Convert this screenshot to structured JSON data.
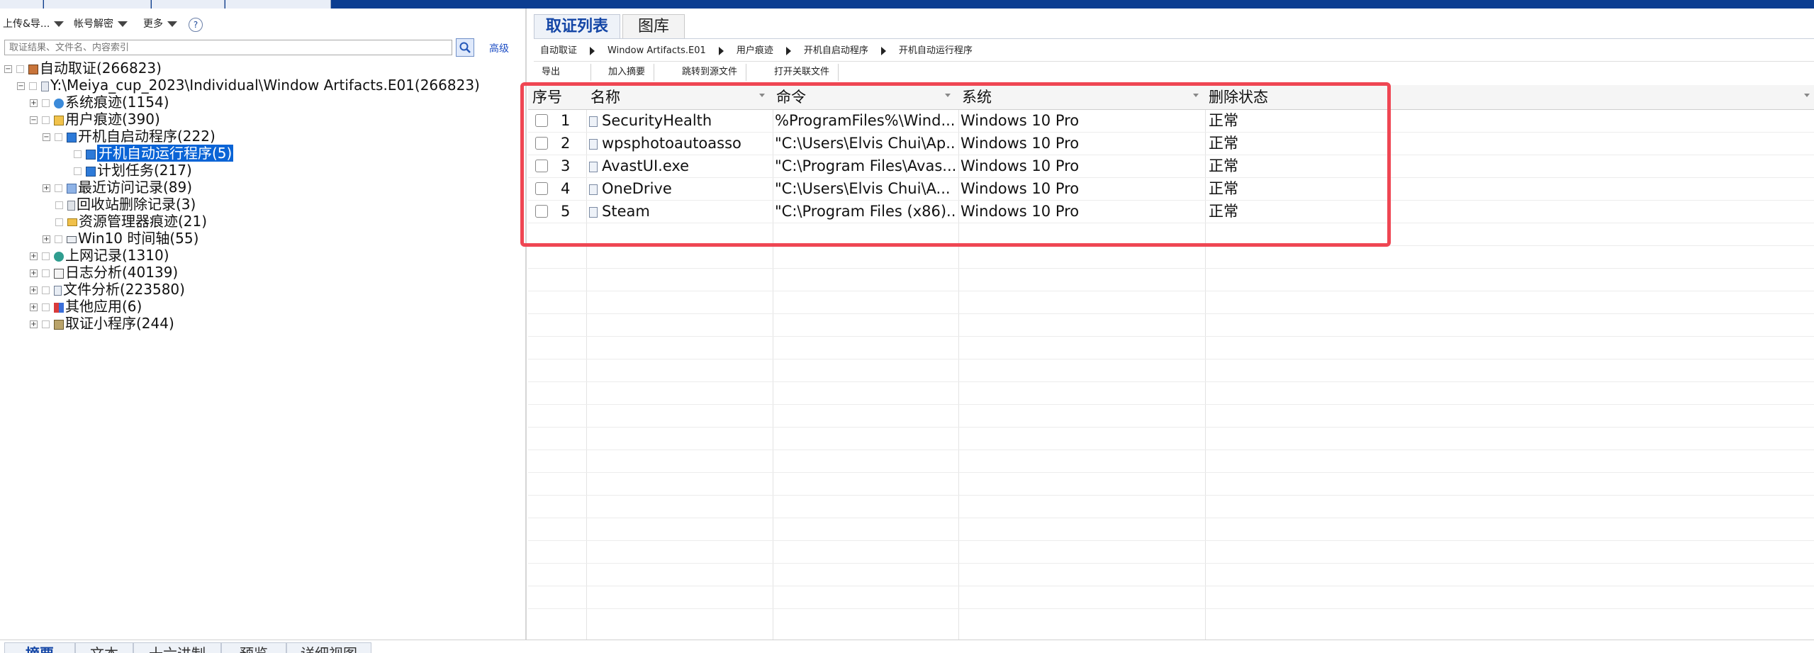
{
  "left_toolbar": {
    "upload_export": "上传&导...",
    "account_decrypt": "帐号解密",
    "more": "更多",
    "help": "?"
  },
  "search": {
    "placeholder": "取证结果、文件名、内容索引",
    "advanced": "高级"
  },
  "tree": [
    {
      "label": "自动取证(266823)"
    },
    {
      "label": "Y:\\Meiya_cup_2023\\Individual\\Window Artifacts.E01(266823)"
    },
    {
      "label": "系统痕迹(1154)"
    },
    {
      "label": "用户痕迹(390)"
    },
    {
      "label": "开机自启动程序(222)"
    },
    {
      "label": "开机自动运行程序(5)"
    },
    {
      "label": "计划任务(217)"
    },
    {
      "label": "最近访问记录(89)"
    },
    {
      "label": "回收站删除记录(3)"
    },
    {
      "label": "资源管理器痕迹(21)"
    },
    {
      "label": "Win10 时间轴(55)"
    },
    {
      "label": "上网记录(1310)"
    },
    {
      "label": "日志分析(40139)"
    },
    {
      "label": "文件分析(223580)"
    },
    {
      "label": "其他应用(6)"
    },
    {
      "label": "取证小程序(244)"
    }
  ],
  "tabs": {
    "evidence_list": "取证列表",
    "gallery": "图库"
  },
  "breadcrumb": [
    "自动取证",
    "Window Artifacts.E01",
    "用户痕迹",
    "开机自启动程序",
    "开机自动运行程序"
  ],
  "actions": {
    "export": "导出",
    "add_summary": "加入摘要",
    "jump_source": "跳转到源文件",
    "open_related": "打开关联文件"
  },
  "grid": {
    "columns": [
      "序号",
      "名称",
      "命令",
      "系统",
      "删除状态"
    ],
    "rows": [
      {
        "no": "1",
        "name": "SecurityHealth",
        "command": "%ProgramFiles%\\Wind...",
        "system": "Windows 10 Pro",
        "status": "正常"
      },
      {
        "no": "2",
        "name": "wpsphotoautoasso",
        "command": "\"C:\\Users\\Elvis Chui\\Ap...",
        "system": "Windows 10 Pro",
        "status": "正常"
      },
      {
        "no": "3",
        "name": "AvastUI.exe",
        "command": "\"C:\\Program Files\\Avas...",
        "system": "Windows 10 Pro",
        "status": "正常"
      },
      {
        "no": "4",
        "name": "OneDrive",
        "command": "\"C:\\Users\\Elvis Chui\\A...",
        "system": "Windows 10 Pro",
        "status": "正常"
      },
      {
        "no": "5",
        "name": "Steam",
        "command": "\"C:\\Program Files (x86)...",
        "system": "Windows 10 Pro",
        "status": "正常"
      }
    ]
  },
  "bottom_tabs": [
    "摘要",
    "文本",
    "十六进制",
    "预览",
    "详细视图"
  ],
  "colors": {
    "accent": "#0b3d91",
    "selection": "#0a64d6",
    "highlight_border": "#ef4653"
  }
}
